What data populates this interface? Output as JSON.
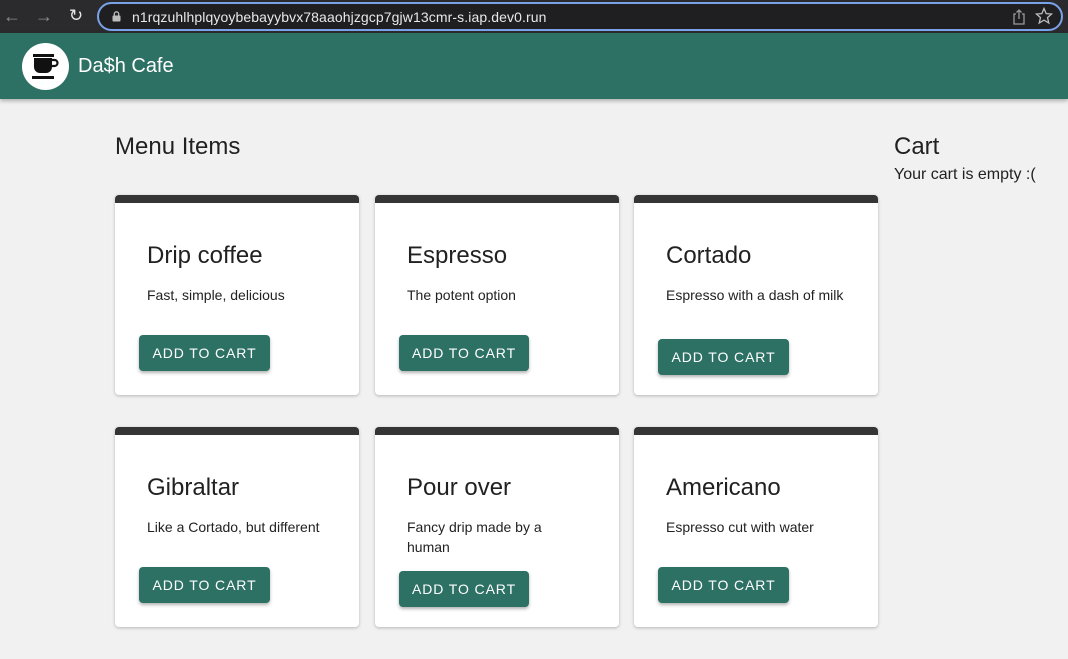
{
  "browser": {
    "url": "n1rqzuhlhplqyoybebayybvx78aaohjzgcp7gjw13cmr-s.iap.dev0.run",
    "icons": [
      "back-icon",
      "forward-icon",
      "reload-icon",
      "lock-icon",
      "share-icon",
      "star-icon"
    ]
  },
  "app": {
    "title": "Da$h Cafe",
    "logo_icon": "coffee-cup-icon",
    "primary_color": "#2d7064"
  },
  "menu": {
    "heading": "Menu Items",
    "items": [
      {
        "name": "Drip coffee",
        "description": "Fast, simple, delicious",
        "button": "ADD TO CART"
      },
      {
        "name": "Espresso",
        "description": "The potent option",
        "button": "ADD TO CART"
      },
      {
        "name": "Cortado",
        "description": "Espresso with a dash of milk",
        "button": "ADD TO CART"
      },
      {
        "name": "Gibraltar",
        "description": "Like a Cortado, but different",
        "button": "ADD TO CART"
      },
      {
        "name": "Pour over",
        "description": "Fancy drip made by a human",
        "button": "ADD TO CART"
      },
      {
        "name": "Americano",
        "description": "Espresso cut with water",
        "button": "ADD TO CART"
      }
    ]
  },
  "cart": {
    "heading": "Cart",
    "empty_message": "Your cart is empty :("
  }
}
